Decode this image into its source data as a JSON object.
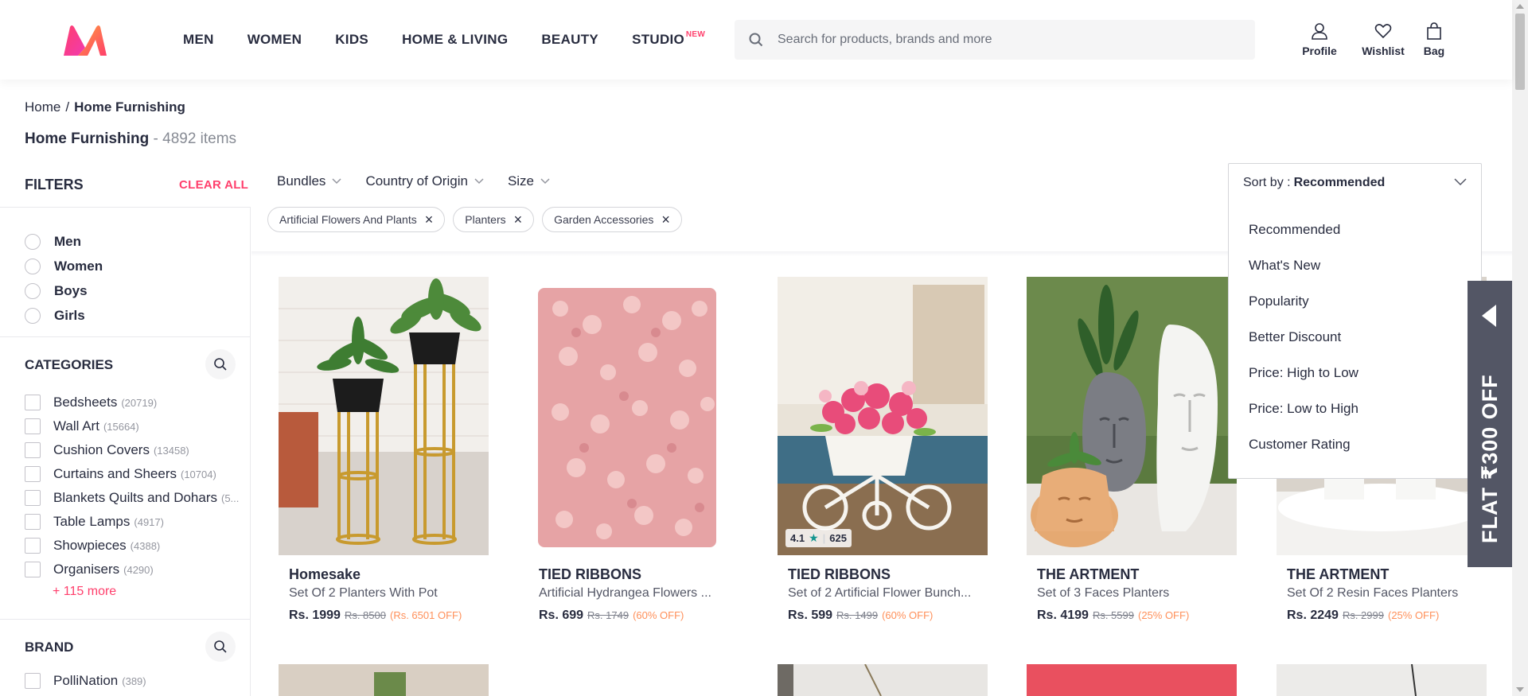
{
  "header": {
    "logo_icon": "myntra-logo-icon",
    "nav": [
      "MEN",
      "WOMEN",
      "KIDS",
      "HOME & LIVING",
      "BEAUTY",
      "STUDIO"
    ],
    "studio_badge": "NEW",
    "search_placeholder": "Search for products, brands and more",
    "actions": {
      "profile": "Profile",
      "wishlist": "Wishlist",
      "bag": "Bag"
    }
  },
  "breadcrumb": {
    "home": "Home",
    "sep": "/",
    "current": "Home Furnishing"
  },
  "page": {
    "title": "Home Furnishing",
    "count": "- 4892 items"
  },
  "filters": {
    "heading": "FILTERS",
    "clear_all": "CLEAR ALL",
    "genders": [
      "Men",
      "Women",
      "Boys",
      "Girls"
    ],
    "categories_heading": "CATEGORIES",
    "categories": [
      {
        "label": "Bedsheets",
        "count": "(20719)"
      },
      {
        "label": "Wall Art",
        "count": "(15664)"
      },
      {
        "label": "Cushion Covers",
        "count": "(13458)"
      },
      {
        "label": "Curtains and Sheers",
        "count": "(10704)"
      },
      {
        "label": "Blankets Quilts and Dohars",
        "count": "(5..."
      },
      {
        "label": "Table Lamps",
        "count": "(4917)"
      },
      {
        "label": "Showpieces",
        "count": "(4388)"
      },
      {
        "label": "Organisers",
        "count": "(4290)"
      }
    ],
    "more": "+ 115 more",
    "brand_heading": "BRAND",
    "brands": [
      {
        "label": "PolliNation",
        "count": "(389)"
      }
    ]
  },
  "filterbar": [
    "Bundles",
    "Country of Origin",
    "Size"
  ],
  "chips": [
    "Artificial Flowers And Plants",
    "Planters",
    "Garden Accessories"
  ],
  "sort": {
    "label": "Sort by :",
    "value": "Recommended",
    "options": [
      "Recommended",
      "What's New",
      "Popularity",
      "Better Discount",
      "Price: High to Low",
      "Price: Low to High",
      "Customer Rating"
    ]
  },
  "products": [
    {
      "brand": "Homesake",
      "name": "Set Of 2 Planters With Pot",
      "price": "Rs. 1999",
      "mrp": "Rs. 8500",
      "off": "(Rs. 6501 OFF)"
    },
    {
      "brand": "TIED RIBBONS",
      "name": "Artificial Hydrangea Flowers ...",
      "price": "Rs. 699",
      "mrp": "Rs. 1749",
      "off": "(60% OFF)"
    },
    {
      "brand": "TIED RIBBONS",
      "name": "Set of 2 Artificial Flower Bunch...",
      "price": "Rs. 599",
      "mrp": "Rs. 1499",
      "off": "(60% OFF)",
      "rating": "4.1",
      "reviews": "625"
    },
    {
      "brand": "THE ARTMENT",
      "name": "Set of 3 Faces Planters",
      "price": "Rs. 4199",
      "mrp": "Rs. 5599",
      "off": "(25% OFF)"
    },
    {
      "brand": "THE ARTMENT",
      "name": "Set Of 2 Resin Faces Planters",
      "price": "Rs. 2249",
      "mrp": "Rs. 2999",
      "off": "(25% OFF)"
    }
  ],
  "promo": {
    "text": "FLAT ₹300 OFF"
  },
  "colors": {
    "accent": "#ff3f6c",
    "discount": "#ff905a",
    "text": "#282c3f",
    "promo_bg": "#535665"
  }
}
